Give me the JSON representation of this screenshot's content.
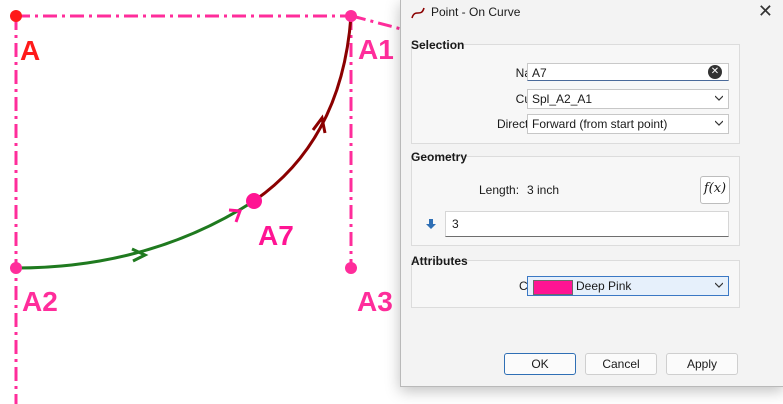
{
  "canvas": {
    "labels": {
      "a": "A",
      "a1": "A1",
      "a2": "A2",
      "a3": "A3",
      "a7": "A7"
    },
    "colors": {
      "construction": "#ff2d9b",
      "point_red": "#ff1a1a",
      "point_pink": "#ff1493",
      "curve_dark": "#8b0000",
      "curve_green": "#1f7a1f"
    }
  },
  "dialog": {
    "title": "Point - On Curve",
    "close_icon": "close-icon",
    "selection": {
      "heading": "Selection",
      "name_label": "Name:",
      "name_value": "A7",
      "curve_label": "Curve:",
      "curve_value": "Spl_A2_A1",
      "direction_label": "Direction :",
      "direction_value": "Forward (from start point)"
    },
    "geometry": {
      "heading": "Geometry",
      "length_label": "Length:",
      "length_value": "3 inch",
      "fx_label": "f(x)",
      "input_value": "3"
    },
    "attributes": {
      "heading": "Attributes",
      "color_label": "Color:",
      "color_value": "Deep Pink",
      "color_hex": "#ff1493"
    },
    "buttons": {
      "ok": "OK",
      "cancel": "Cancel",
      "apply": "Apply"
    }
  }
}
